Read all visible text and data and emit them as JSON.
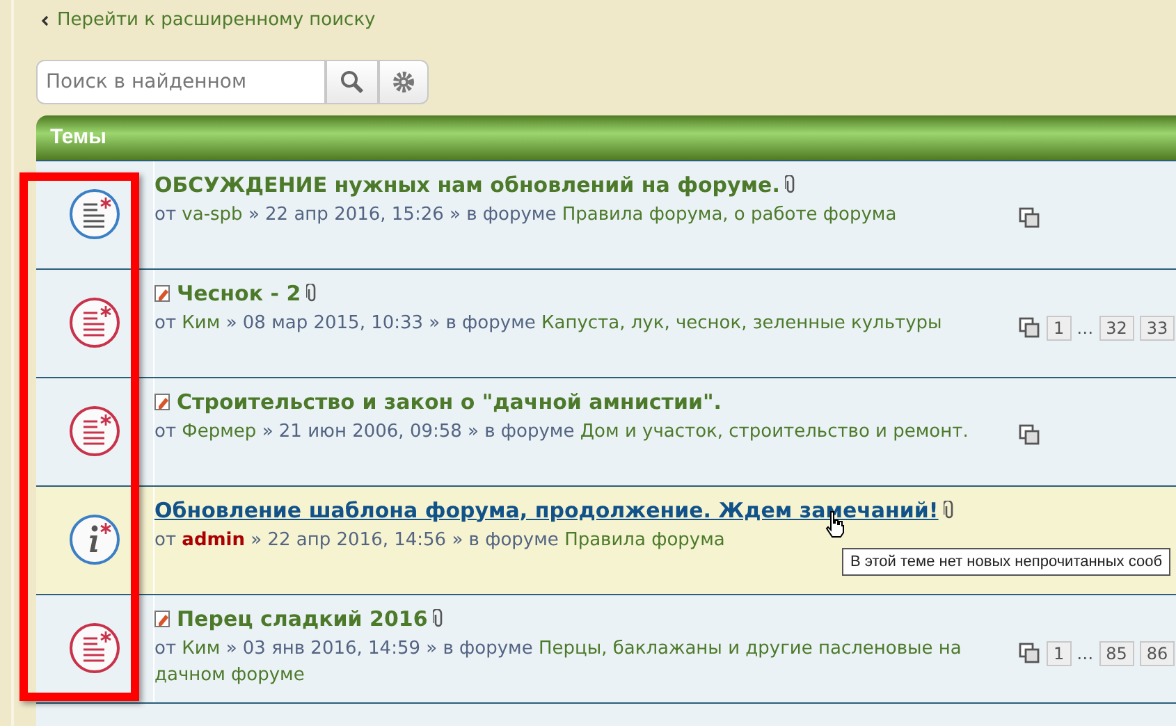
{
  "back_link": {
    "label": "Перейти к расширенному поиску"
  },
  "search": {
    "placeholder": "Поиск в найденном"
  },
  "section": {
    "title": "Темы"
  },
  "topics": [
    {
      "kind": "unread",
      "highlighted": false,
      "hovered": false,
      "hot": false,
      "attachment": true,
      "title": "ОБСУЖДЕНИЕ нужных нам обновлений на форуме.",
      "by": "от",
      "author": "va-spb",
      "admin": false,
      "date": "» 22 апр 2016, 15:26 » в форуме",
      "forum": "Правила форума, о работе форума"
    },
    {
      "kind": "read",
      "highlighted": false,
      "hovered": false,
      "hot": true,
      "attachment": true,
      "title": "Чеснок - 2",
      "by": "от",
      "author": "Ким",
      "admin": false,
      "date": "» 08 мар 2015, 10:33 » в форуме",
      "forum": "Капуста, лук, чеснок, зеленные культуры",
      "pages": [
        "1",
        "…",
        "32",
        "33"
      ]
    },
    {
      "kind": "read",
      "highlighted": false,
      "hovered": false,
      "hot": true,
      "attachment": false,
      "title": "Строительство и закон о \"дачной амнистии\".",
      "by": "от",
      "author": "Фермер",
      "admin": false,
      "date": "» 21 июн 2006, 09:58 » в форуме",
      "forum": "Дом и участок, строительство и ремонт."
    },
    {
      "kind": "announcement",
      "highlighted": true,
      "hovered": true,
      "hot": false,
      "attachment": true,
      "title": "Обновление шаблона форума, продолжение. Ждем замечаний!",
      "by": "от",
      "author": "admin",
      "admin": true,
      "date": "» 22 апр 2016, 14:56 » в форуме",
      "forum": "Правила форума"
    },
    {
      "kind": "read",
      "highlighted": false,
      "hovered": false,
      "hot": true,
      "attachment": true,
      "title": "Перец сладкий 2016",
      "by": "от",
      "author": "Ким",
      "admin": false,
      "date": "» 03 янв 2016, 14:59 » в форуме",
      "forum": "Перцы, баклажаны и другие пасленовые на дачном форуме",
      "pages": [
        "1",
        "…",
        "85",
        "86"
      ]
    }
  ],
  "tooltip": {
    "text": "В этой теме нет новых непрочитанных сооб"
  }
}
